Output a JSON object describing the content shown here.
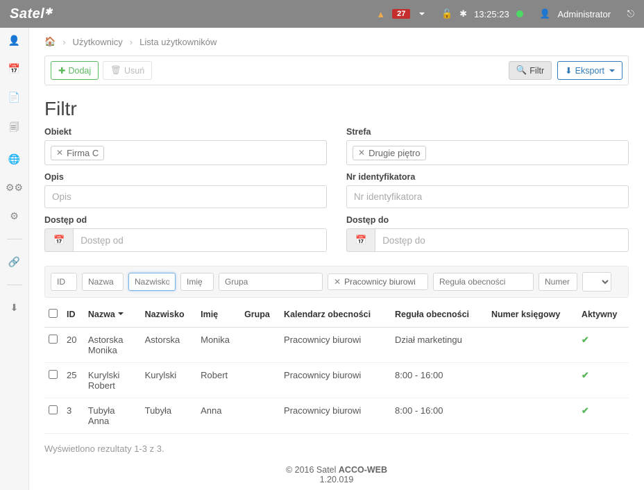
{
  "topbar": {
    "logo": "Satel",
    "alert_count": "27",
    "time": "13:25:23",
    "user_label": "Administrator"
  },
  "breadcrumb": {
    "item1": "Użytkownicy",
    "item2": "Lista użytkowników"
  },
  "toolbar": {
    "add_label": "Dodaj",
    "delete_label": "Usuń",
    "filter_label": "Filtr",
    "export_label": "Eksport"
  },
  "filter": {
    "title": "Filtr",
    "obiekt_label": "Obiekt",
    "obiekt_tag": "Firma C",
    "strefa_label": "Strefa",
    "strefa_tag": "Drugie piętro",
    "opis_label": "Opis",
    "opis_placeholder": "Opis",
    "nrident_label": "Nr identyfikatora",
    "nrident_placeholder": "Nr identyfikatora",
    "dostep_od_label": "Dostęp od",
    "dostep_od_placeholder": "Dostęp od",
    "dostep_do_label": "Dostęp do",
    "dostep_do_placeholder": "Dostęp do"
  },
  "colfilter": {
    "id": "ID",
    "nazwa": "Nazwa",
    "nazwisko": "Nazwisko",
    "imie": "Imię",
    "grupa": "Grupa",
    "kalendarz_tag": "Pracownicy biurowi",
    "regula": "Reguła obecności",
    "numer": "Numer ksi"
  },
  "table": {
    "headers": {
      "id": "ID",
      "nazwa": "Nazwa",
      "nazwisko": "Nazwisko",
      "imie": "Imię",
      "grupa": "Grupa",
      "kalendarz": "Kalendarz obecności",
      "regula": "Reguła obecności",
      "numer": "Numer księgowy",
      "aktywny": "Aktywny"
    },
    "rows": [
      {
        "id": "20",
        "nazwa": "Astorska Monika",
        "nazwisko": "Astorska",
        "imie": "Monika",
        "grupa": "",
        "kalendarz": "Pracownicy biurowi",
        "regula": "Dział marketingu",
        "numer": "",
        "aktywny": true
      },
      {
        "id": "25",
        "nazwa": "Kurylski Robert",
        "nazwisko": "Kurylski",
        "imie": "Robert",
        "grupa": "",
        "kalendarz": "Pracownicy biurowi",
        "regula": "8:00 - 16:00",
        "numer": "",
        "aktywny": true
      },
      {
        "id": "3",
        "nazwa": "Tubyła Anna",
        "nazwisko": "Tubyła",
        "imie": "Anna",
        "grupa": "",
        "kalendarz": "Pracownicy biurowi",
        "regula": "8:00 - 16:00",
        "numer": "",
        "aktywny": true
      }
    ]
  },
  "results_text": "Wyświetlono rezultaty 1-3 z 3.",
  "footer": {
    "line1_prefix": "© 2016 Satel ",
    "line1_bold": "ACCO-WEB",
    "line2": "1.20.019"
  }
}
